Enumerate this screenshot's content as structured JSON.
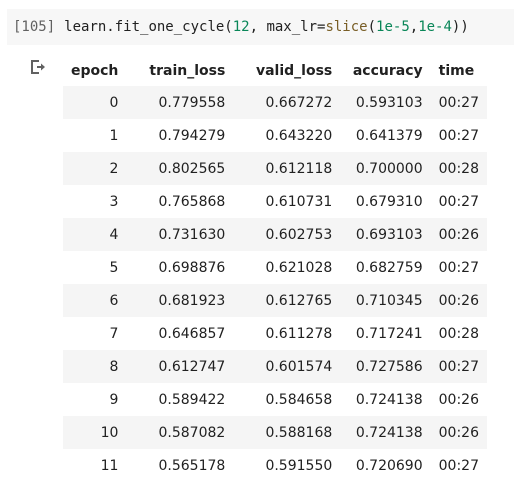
{
  "cell": {
    "prompt": "[105]",
    "code_parts": [
      {
        "text": "learn.fit_one_cycle(",
        "type": "plain"
      },
      {
        "text": "12",
        "type": "num"
      },
      {
        "text": ", max_lr=",
        "type": "plain"
      },
      {
        "text": "slice",
        "type": "builtin"
      },
      {
        "text": "(",
        "type": "plain"
      },
      {
        "text": "1e-5",
        "type": "num"
      },
      {
        "text": ",",
        "type": "plain"
      },
      {
        "text": "1e-4",
        "type": "num"
      },
      {
        "text": "))",
        "type": "plain"
      }
    ]
  },
  "output": {
    "icon": "output-arrow-icon",
    "columns": [
      "epoch",
      "train_loss",
      "valid_loss",
      "accuracy",
      "time"
    ],
    "rows": [
      [
        "0",
        "0.779558",
        "0.667272",
        "0.593103",
        "00:27"
      ],
      [
        "1",
        "0.794279",
        "0.643220",
        "0.641379",
        "00:27"
      ],
      [
        "2",
        "0.802565",
        "0.612118",
        "0.700000",
        "00:28"
      ],
      [
        "3",
        "0.765868",
        "0.610731",
        "0.679310",
        "00:27"
      ],
      [
        "4",
        "0.731630",
        "0.602753",
        "0.693103",
        "00:26"
      ],
      [
        "5",
        "0.698876",
        "0.621028",
        "0.682759",
        "00:27"
      ],
      [
        "6",
        "0.681923",
        "0.612765",
        "0.710345",
        "00:26"
      ],
      [
        "7",
        "0.646857",
        "0.611278",
        "0.717241",
        "00:28"
      ],
      [
        "8",
        "0.612747",
        "0.601574",
        "0.727586",
        "00:27"
      ],
      [
        "9",
        "0.589422",
        "0.584658",
        "0.724138",
        "00:26"
      ],
      [
        "10",
        "0.587082",
        "0.588168",
        "0.724138",
        "00:26"
      ],
      [
        "11",
        "0.565178",
        "0.591550",
        "0.720690",
        "00:27"
      ]
    ]
  },
  "colors": {
    "cell_background": "#f7f7f7",
    "number_color": "#098658",
    "builtin_color": "#795e26",
    "row_stripe": "#f5f5f5"
  }
}
